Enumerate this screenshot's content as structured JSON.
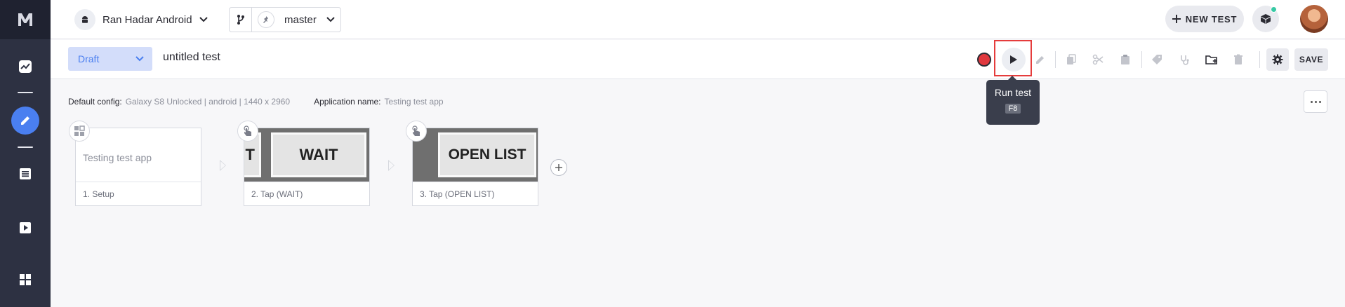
{
  "sidebar": {
    "logo": "M",
    "items": [
      {
        "icon": "activity-icon"
      },
      {
        "icon": "edit-icon",
        "active": true
      },
      {
        "icon": "list-icon"
      },
      {
        "icon": "play-icon"
      },
      {
        "icon": "grid-icon"
      }
    ]
  },
  "header": {
    "app_name": "Ran Hadar Android",
    "branch": "master",
    "new_test_label": "NEW TEST"
  },
  "toolbar": {
    "status": "Draft",
    "title": "untitled test",
    "save_label": "SAVE"
  },
  "tooltip": {
    "label": "Run test",
    "shortcut": "F8"
  },
  "config": {
    "default_config_label": "Default config:",
    "default_config_value": "Galaxy S8 Unlocked | android | 1440 x 2960",
    "app_name_label": "Application name:",
    "app_name_value": "Testing test app"
  },
  "steps": [
    {
      "caption": "1. Setup",
      "thumb_text": "Testing test app"
    },
    {
      "caption": "2. Tap (WAIT)",
      "thumb_text": "WAIT",
      "thumb_prefix": "T"
    },
    {
      "caption": "3. Tap (OPEN LIST)",
      "thumb_text": "OPEN LIST"
    }
  ],
  "colors": {
    "accent": "#4a7ff0",
    "sidebar": "#2d3142",
    "record": "#e0383e",
    "highlight": "#e53c3c"
  }
}
